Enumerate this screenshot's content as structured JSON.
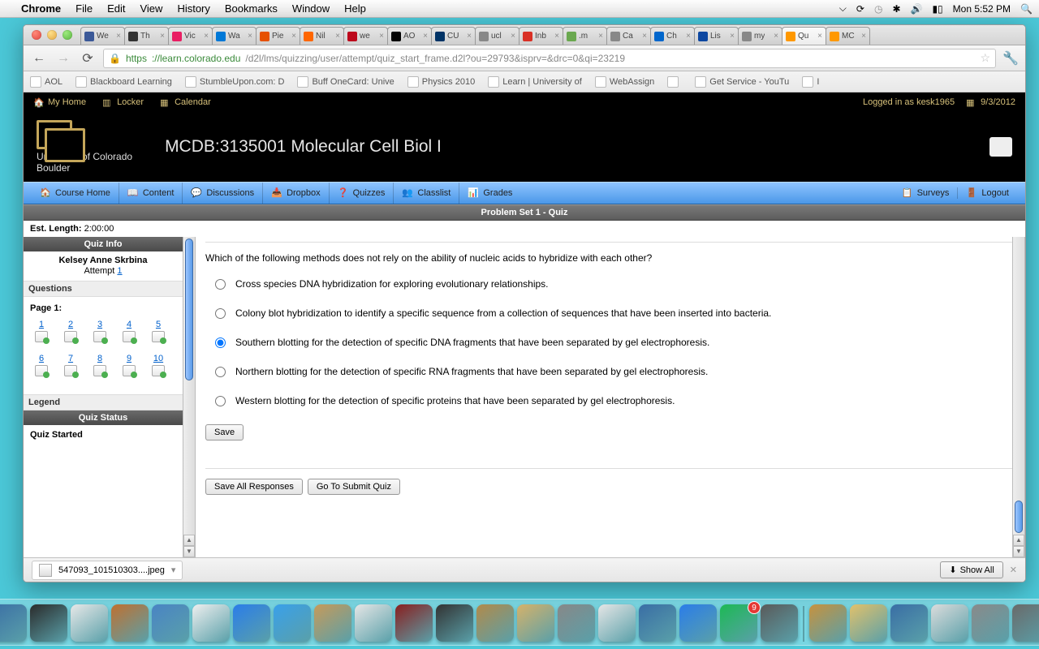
{
  "mac": {
    "app": "Chrome",
    "menus": [
      "File",
      "Edit",
      "View",
      "History",
      "Bookmarks",
      "Window",
      "Help"
    ],
    "clock": "Mon 5:52 PM"
  },
  "tabs": [
    {
      "fav": "#3b5998",
      "t": "We"
    },
    {
      "fav": "#333",
      "t": "Th"
    },
    {
      "fav": "#e91e63",
      "t": "Vic"
    },
    {
      "fav": "#0078d7",
      "t": "Wa"
    },
    {
      "fav": "#e65100",
      "t": "Pie"
    },
    {
      "fav": "#ff6600",
      "t": "Nil"
    },
    {
      "fav": "#bd081c",
      "t": "we"
    },
    {
      "fav": "#000",
      "t": "AO"
    },
    {
      "fav": "#003366",
      "t": "CU"
    },
    {
      "fav": "#888",
      "t": "ucl"
    },
    {
      "fav": "#d93025",
      "t": "Inb"
    },
    {
      "fav": "#6aa84f",
      "t": ".m"
    },
    {
      "fav": "#888",
      "t": "Ca"
    },
    {
      "fav": "#0066cc",
      "t": "Ch"
    },
    {
      "fav": "#0d47a1",
      "t": "Lis"
    },
    {
      "fav": "#888",
      "t": "my"
    },
    {
      "fav": "#ff9800",
      "t": "Qu",
      "active": true
    },
    {
      "fav": "#ff9800",
      "t": "MC"
    }
  ],
  "url": {
    "proto": "https",
    "host": "://learn.colorado.edu",
    "path": "/d2l/lms/quizzing/user/attempt/quiz_start_frame.d2l?ou=29793&isprv=&drc=0&qi=23219"
  },
  "bookmarks": [
    "AOL",
    "Blackboard Learning",
    "StumbleUpon.com: D",
    "Buff OneCard: Unive",
    "Physics 2010",
    "Learn | University of",
    "WebAssign",
    "",
    "Get Service - YouTu",
    "I"
  ],
  "d2l_top": {
    "home": "My Home",
    "locker": "Locker",
    "cal": "Calendar",
    "login": "Logged in as kesk1965",
    "date": "9/3/2012"
  },
  "uni": {
    "l1": "University of Colorado",
    "l2": "Boulder"
  },
  "course": "MCDB:3135001 Molecular Cell Biol I",
  "nav": [
    "Course Home",
    "Content",
    "Discussions",
    "Dropbox",
    "Quizzes",
    "Classlist",
    "Grades"
  ],
  "nav_r": [
    "Surveys",
    "Logout"
  ],
  "quiz_title": "Problem Set 1 - Quiz",
  "est_label": "Est. Length:",
  "est_val": " 2:00:00",
  "side": {
    "info": "Quiz Info",
    "name": "Kelsey Anne Skrbina",
    "attempt": "Attempt ",
    "attempt_n": "1",
    "questions": "Questions",
    "page": "Page 1:",
    "legend": "Legend",
    "status_h": "Quiz Status",
    "status": "Quiz Started",
    "nums": [
      "1",
      "2",
      "3",
      "4",
      "5",
      "6",
      "7",
      "8",
      "9",
      "10"
    ]
  },
  "q": {
    "text": "Which of the following methods does not rely on the ability of nucleic acids to hybridize with each other?",
    "opts": [
      "Cross species DNA hybridization for exploring evolutionary relationships.",
      "Colony blot hybridization to identify a specific sequence from a collection of sequences that have been inserted into bacteria.",
      "Southern blotting for the detection of specific DNA fragments that have been separated by gel electrophoresis.",
      "Northern blotting for the detection of specific RNA fragments that have been separated by gel electrophoresis.",
      "Western blotting for the detection of specific proteins that have been separated by gel electrophoresis."
    ],
    "selected": 2,
    "save": "Save",
    "save_all": "Save All Responses",
    "submit": "Go To Submit Quiz"
  },
  "dl": {
    "file": "547093_101510303....jpeg",
    "showall": "Show All"
  },
  "dock_colors": [
    "#3b6ea5",
    "#2b2b2b",
    "#e8e8e8",
    "#c07030",
    "#4a84c4",
    "#efefef",
    "#2b7de9",
    "#3aa0ea",
    "#c79a5a",
    "#e6e6e6",
    "#8a1e1e",
    "#333",
    "#b28a4a",
    "#d6b26a",
    "#888",
    "#e6e6e6",
    "#3a6ea5",
    "#2b7de9",
    "#1db954",
    "#5a5a5a",
    "#c7923e",
    "#e2c16b",
    "#3a6ea5",
    "#dcdcdc",
    "#8a8a8a",
    "#6a6a6a"
  ],
  "dock_badge": "9"
}
